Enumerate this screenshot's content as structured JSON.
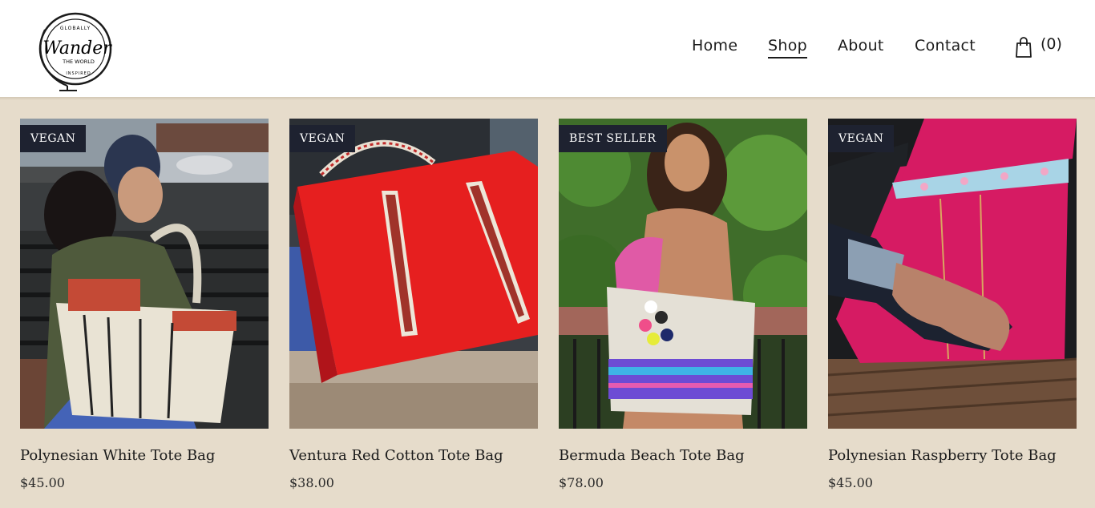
{
  "header": {
    "logo": {
      "top_text": "GLOBALLY",
      "main_text": "Wander",
      "sub_text": "THE WORLD",
      "bottom_text": "INSPIRED"
    },
    "nav": [
      {
        "label": "Home",
        "active": false
      },
      {
        "label": "Shop",
        "active": true
      },
      {
        "label": "About",
        "active": false
      },
      {
        "label": "Contact",
        "active": false
      }
    ],
    "cart": {
      "icon": "shopping-bag-icon",
      "count_label": "(0)"
    }
  },
  "products": [
    {
      "badge": "VEGAN",
      "title": "Polynesian White Tote Bag",
      "price": "$45.00"
    },
    {
      "badge": "VEGAN",
      "title": "Ventura Red Cotton Tote Bag",
      "price": "$38.00"
    },
    {
      "badge": "BEST SELLER",
      "title": "Bermuda Beach Tote Bag",
      "price": "$78.00"
    },
    {
      "badge": "VEGAN",
      "title": "Polynesian Raspberry Tote Bag",
      "price": "$45.00"
    }
  ],
  "colors": {
    "page_background": "#e6dccb",
    "header_background": "#ffffff",
    "badge_background": "#1e2230"
  }
}
